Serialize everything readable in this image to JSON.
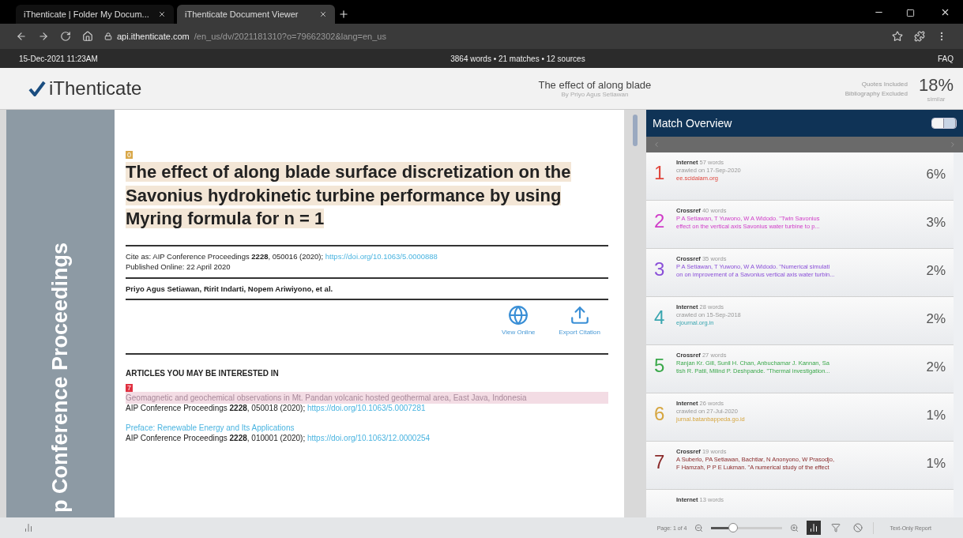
{
  "browser": {
    "tabs": [
      {
        "label": "iThenticate | Folder My Docum...",
        "selected": false
      },
      {
        "label": "iThenticate Document Viewer",
        "selected": true
      }
    ],
    "url_host": "api.ithenticate.com",
    "url_path": "/en_us/dv/2021181310?o=79662302&lang=en_us"
  },
  "info_bar": {
    "date": "15-Dec-2021 11:23AM",
    "summary": "3864 words • 21 matches • 12 sources",
    "faq": "FAQ"
  },
  "header": {
    "logo": "iThenticate",
    "title": "The effect of along blade",
    "subtitle": "By Priyo Agus Setiawan",
    "filters": [
      "Quotes Included",
      "Bibliography Excluded"
    ],
    "score": "18%",
    "score_label": "similar"
  },
  "document": {
    "side_banner": "p Conference Proceedings",
    "title_marker": "0",
    "title": "The effect of along blade surface discretization on the Savonius hydrokinetic turbine performance by using Myring formula for n = 1",
    "cite": "Cite as: AIP Conference Proceedings **2228**, 050016 (2020); ",
    "cite_link": "https://doi.org/10.1063/5.0000888",
    "published": "Published Online: 22 April 2020",
    "authors": "Priyo Agus Setiawan, Ririt Indarti, Nopem Ariwiyono, et al.",
    "actions": [
      "View Online",
      "Export Citation"
    ],
    "articles_heading": "ARTICLES YOU MAY BE INTERESTED IN",
    "articles": [
      {
        "marker": "7",
        "title": "Geomagnetic and geochemical observations in Mt. Pandan volcanic hosted geothermal area, East Java, Indonesia",
        "highlighted": true,
        "ref": "AIP Conference Proceedings **2228**, 050018 (2020); ",
        "link": "https://doi.org/10.1063/5.0007281"
      },
      {
        "title": "Preface: Renewable Energy and Its Applications",
        "highlighted": false,
        "ref": "AIP Conference Proceedings **2228**, 010001 (2020); ",
        "link": "https://doi.org/10.1063/12.0000254"
      }
    ]
  },
  "match_overview": {
    "title": "Match Overview",
    "view_modes": [
      {
        "selected": false
      },
      {
        "selected": true
      }
    ],
    "matches": [
      {
        "number": "1",
        "color": "#e0463c",
        "kind": "internet",
        "source": "Internet",
        "words": "57 words",
        "line_1": "crawled on 17-Sep-2020",
        "line_2": "ee.scidalam.org",
        "percent": "6%"
      },
      {
        "number": "2",
        "color": "#d03cc8",
        "kind": "crossref",
        "source": "Crossref",
        "words": "40 words",
        "line_1": "P A Setiawan, T Yuwono, W A Widodo. \"Twin Savonius",
        "line_2": "effect on the vertical axis Savonius water turbine to p...",
        "percent": "3%"
      },
      {
        "number": "3",
        "color": "#8a4fd8",
        "kind": "crossref",
        "source": "Crossref",
        "words": "35 words",
        "line_1": "P A Setiawan, T Yuwono, W A Widodo. \"Numerical simulati",
        "line_2": "on on improvement of a Savonius vertical axis water turbin...",
        "percent": "2%"
      },
      {
        "number": "4",
        "color": "#3aa6b0",
        "kind": "internet",
        "source": "Internet",
        "words": "28 words",
        "line_1": "crawled on 15-Sep-2018",
        "line_2": "ejournal.org.in",
        "percent": "2%"
      },
      {
        "number": "5",
        "color": "#3aa84a",
        "kind": "crossref",
        "source": "Crossref",
        "words": "27 words",
        "line_1": "Ranjan Kr. Gill, Sunil H. Chan, Anbuchamar J. Kannan, Sa",
        "line_2": "tish R. Patil, Milind P. Deshpande. \"Thermal investigation...",
        "percent": "2%"
      },
      {
        "number": "6",
        "color": "#d6a640",
        "kind": "internet",
        "source": "Internet",
        "words": "26 words",
        "line_1": "crawled on 27-Jul-2020",
        "line_2": "jurnal.batanbappeda.go.id",
        "percent": "1%"
      },
      {
        "number": "7",
        "color": "#8a2a2a",
        "kind": "crossref",
        "source": "Crossref",
        "words": "19 words",
        "line_1": "A Suberlo, PA Setiawan, Bachtiar, N Anonyono, W Prasodjo,",
        "line_2": "F Hamzah, P P E Lukman. \"A numerical study of the effect",
        "percent": "1%"
      },
      {
        "source": "Internet",
        "words": "13 words"
      }
    ]
  },
  "bottom_bar": {
    "page": "Page: 1 of 4",
    "zoom": {
      "level": 0.3
    },
    "report": "Text-Only Report"
  }
}
